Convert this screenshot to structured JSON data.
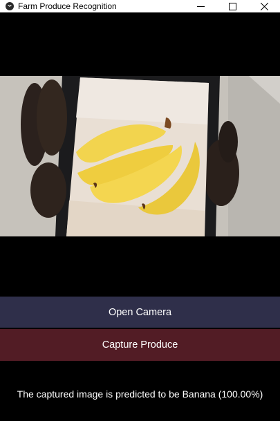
{
  "window": {
    "title": "Farm Produce Recognition",
    "icon": "kivy-logo-icon",
    "controls": [
      "minimize-icon",
      "maximize-icon",
      "close-icon"
    ]
  },
  "preview": {
    "content": "camera-frame-banana-photo"
  },
  "buttons": {
    "open_camera": "Open Camera",
    "capture_produce": "Capture Produce"
  },
  "result": {
    "text": "The captured image is predicted to be Banana (100.00%)"
  },
  "colors": {
    "background": "#000000",
    "open_camera_bg": "#2f2f4a",
    "capture_bg": "#521c25",
    "text": "#ffffff"
  }
}
